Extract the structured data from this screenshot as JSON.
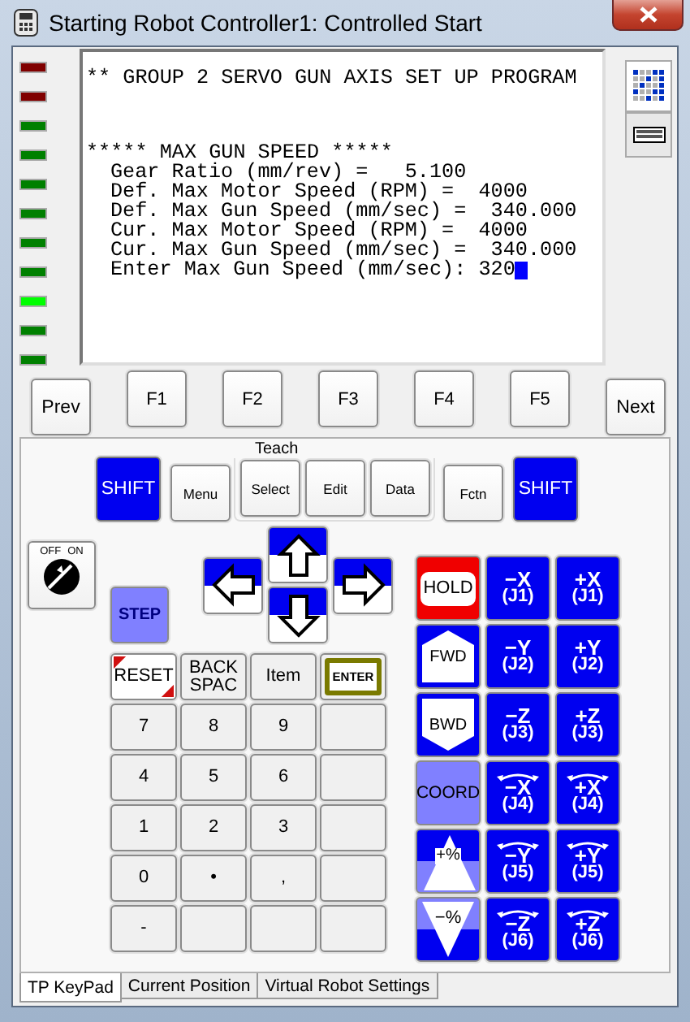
{
  "window": {
    "title": "Starting Robot Controller1: Controlled Start"
  },
  "leds": [
    {
      "color": "#800000"
    },
    {
      "color": "#800000"
    },
    {
      "color": "#008000"
    },
    {
      "color": "#008000"
    },
    {
      "color": "#008000"
    },
    {
      "color": "#008000"
    },
    {
      "color": "#008000"
    },
    {
      "color": "#008000"
    },
    {
      "color": "#00ff00"
    },
    {
      "color": "#008000"
    },
    {
      "color": "#008000"
    }
  ],
  "screen": {
    "heading": "** GROUP 2 SERVO GUN AXIS SET UP PROGRAM",
    "section_title": "***** MAX GUN SPEED *****",
    "lines": [
      "Gear Ratio (mm/rev) =   5.100",
      "Def. Max Motor Speed (RPM) =  4000",
      "Def. Max Gun Speed (mm/sec) =  340.000",
      "Cur. Max Motor Speed (RPM) =  4000",
      "Cur. Max Gun Speed (mm/sec) =  340.000"
    ],
    "input": {
      "prompt": "Enter Max Gun Speed (mm/sec):",
      "value": "320"
    }
  },
  "side_tabs": [
    {
      "kind": "display",
      "selected": true
    },
    {
      "kind": "keyboard",
      "selected": false
    }
  ],
  "function_keys": [
    {
      "label": "Prev",
      "kind": "nav"
    },
    {
      "label": "F1",
      "kind": "function"
    },
    {
      "label": "F2",
      "kind": "function"
    },
    {
      "label": "F3",
      "kind": "function"
    },
    {
      "label": "F4",
      "kind": "function"
    },
    {
      "label": "F5",
      "kind": "function"
    },
    {
      "label": "Next",
      "kind": "nav"
    }
  ],
  "keypad": {
    "left_keys": [
      {
        "label": "SHIFT",
        "kind": "shift"
      },
      {
        "label": "Menu",
        "kind": "small"
      }
    ],
    "teach_group": {
      "label": "Teach",
      "keys": [
        "Select",
        "Edit",
        "Data"
      ]
    },
    "right_keys": [
      {
        "label": "Fctn",
        "kind": "small"
      },
      {
        "label": "SHIFT",
        "kind": "shift"
      }
    ],
    "key_switch": {
      "off_label": "OFF",
      "on_label": "ON",
      "on": false
    },
    "step": "STEP",
    "numpad": [
      {
        "label": "RESET",
        "kind": "reset"
      },
      {
        "label": "BACK SPAC",
        "kind": "plain"
      },
      {
        "label": "Item",
        "kind": "plain"
      },
      {
        "label": "ENTER",
        "kind": "enter"
      },
      {
        "label": "7",
        "kind": "digit"
      },
      {
        "label": "8",
        "kind": "digit"
      },
      {
        "label": "9",
        "kind": "digit"
      },
      {
        "kind": "blank"
      },
      {
        "label": "4",
        "kind": "digit"
      },
      {
        "label": "5",
        "kind": "digit"
      },
      {
        "label": "6",
        "kind": "digit"
      },
      {
        "kind": "blank"
      },
      {
        "label": "1",
        "kind": "digit"
      },
      {
        "label": "2",
        "kind": "digit"
      },
      {
        "label": "3",
        "kind": "digit"
      },
      {
        "kind": "blank"
      },
      {
        "label": "0",
        "kind": "digit"
      },
      {
        "label": "•",
        "kind": "digit"
      },
      {
        "label": ",",
        "kind": "digit"
      },
      {
        "kind": "blank"
      },
      {
        "label": "-",
        "kind": "digit"
      },
      {
        "kind": "blank"
      },
      {
        "kind": "blank"
      },
      {
        "kind": "blank"
      }
    ],
    "jog_keys": [
      {
        "label": "HOLD",
        "kind": "hold"
      },
      {
        "label": "−X",
        "sub": "(J1)",
        "kind": "jog"
      },
      {
        "label": "+X",
        "sub": "(J1)",
        "kind": "jog"
      },
      {
        "label": "FWD",
        "kind": "fwd"
      },
      {
        "label": "−Y",
        "sub": "(J2)",
        "kind": "jog"
      },
      {
        "label": "+Y",
        "sub": "(J2)",
        "kind": "jog"
      },
      {
        "label": "BWD",
        "kind": "bwd"
      },
      {
        "label": "−Z",
        "sub": "(J3)",
        "kind": "jog"
      },
      {
        "label": "+Z",
        "sub": "(J3)",
        "kind": "jog"
      },
      {
        "label": "COORD",
        "kind": "coord"
      },
      {
        "label": "−X",
        "sub": "(J4)",
        "kind": "jog_rot"
      },
      {
        "label": "+X",
        "sub": "(J4)",
        "kind": "jog_rot"
      },
      {
        "label": "+%",
        "kind": "speed_up"
      },
      {
        "label": "−Y",
        "sub": "(J5)",
        "kind": "jog_rot"
      },
      {
        "label": "+Y",
        "sub": "(J5)",
        "kind": "jog_rot"
      },
      {
        "label": "−%",
        "kind": "speed_down"
      },
      {
        "label": "−Z",
        "sub": "(J6)",
        "kind": "jog_rot"
      },
      {
        "label": "+Z",
        "sub": "(J6)",
        "kind": "jog_rot"
      }
    ]
  },
  "tabs": [
    {
      "label": "TP KeyPad",
      "selected": true
    },
    {
      "label": "Current Position",
      "selected": false
    },
    {
      "label": "Virtual Robot Settings",
      "selected": false
    }
  ]
}
